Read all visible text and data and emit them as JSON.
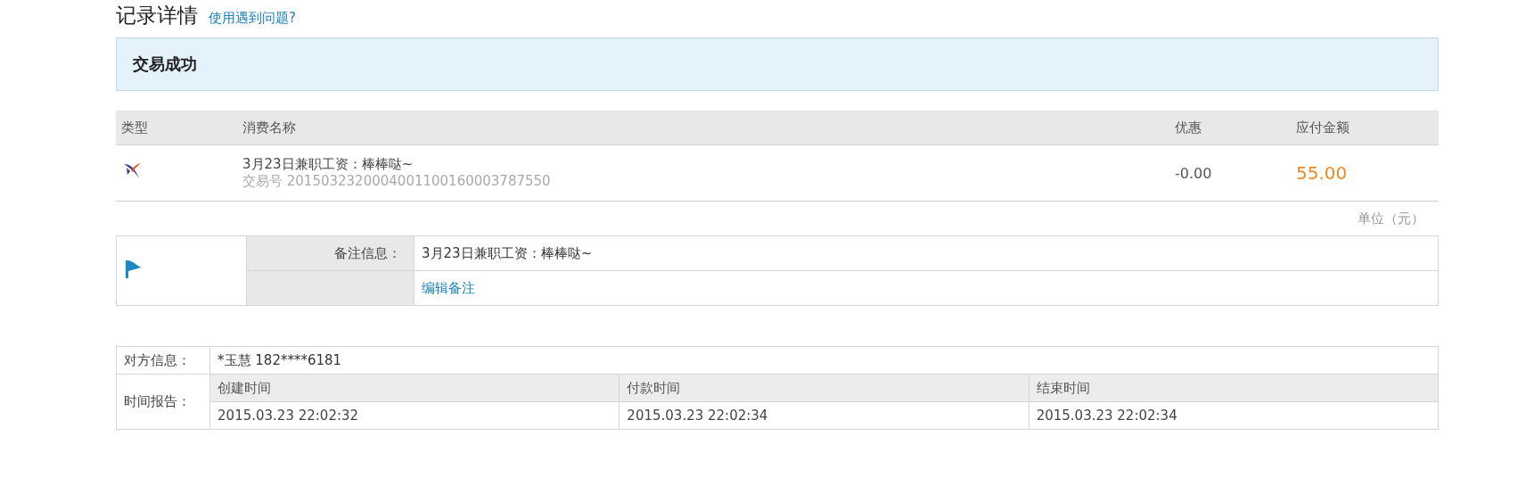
{
  "page": {
    "title": "记录详情",
    "help_link": "使用遇到问题?"
  },
  "status": {
    "text": "交易成功"
  },
  "orders": {
    "columns": [
      "类型",
      "消费名称",
      "优惠",
      "应付金额"
    ],
    "rows": [
      {
        "name": "3月23日兼职工资：棒棒哒~",
        "trade_no": "交易号 2015032320004001100160003787550",
        "discount": "-0.00",
        "amount": "55.00"
      }
    ],
    "unit": "单位（元）"
  },
  "remark": {
    "label": "备注信息：",
    "value": "3月23日兼职工资：棒棒哒~",
    "edit_link": "编辑备注"
  },
  "party": {
    "label": "对方信息：",
    "value": "*玉慧 182****6181"
  },
  "time_report": {
    "label": "时间报告：",
    "columns": [
      "创建时间",
      "付款时间",
      "结束时间"
    ],
    "values": [
      "2015.03.23 22:02:32",
      "2015.03.23 22:02:34",
      "2015.03.23 22:02:34"
    ]
  }
}
